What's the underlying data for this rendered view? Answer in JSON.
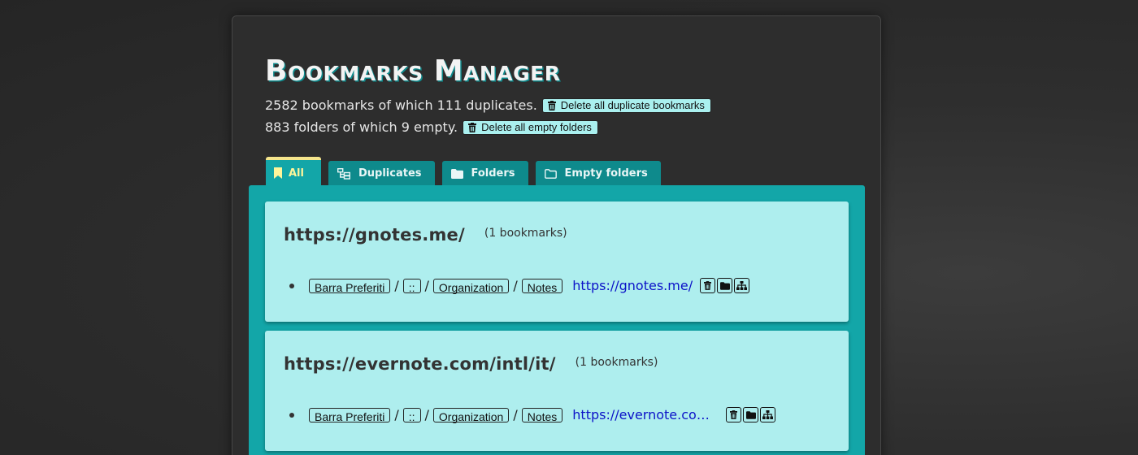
{
  "app": {
    "title": "Bookmarks Manager"
  },
  "stats": {
    "bookmarks_text": "2582 bookmarks of which 111 duplicates.",
    "delete_duplicates_label": "Delete all duplicate bookmarks",
    "folders_text": "883 folders of which 9 empty.",
    "delete_empty_label": "Delete all empty folders"
  },
  "tabs": [
    {
      "label": "All",
      "icon": "bookmark-icon",
      "active": true
    },
    {
      "label": "Duplicates",
      "icon": "tree-icon",
      "active": false
    },
    {
      "label": "Folders",
      "icon": "folder-icon",
      "active": false
    },
    {
      "label": "Empty folders",
      "icon": "folder-open-outline-icon",
      "active": false
    }
  ],
  "groups": [
    {
      "url": "https://gnotes.me/",
      "count_text": "(1 bookmarks)",
      "bookmarks": [
        {
          "path": [
            "Barra Preferiti",
            "::",
            "Organization",
            "Notes"
          ],
          "link": "https://gnotes.me/",
          "actions": [
            "trash-icon",
            "folder-icon",
            "sitemap-icon"
          ]
        }
      ]
    },
    {
      "url": "https://evernote.com/intl/it/",
      "count_text": "(1 bookmarks)",
      "bookmarks": [
        {
          "path": [
            "Barra Preferiti",
            "::",
            "Organization",
            "Notes"
          ],
          "link": "https://evernote.com...",
          "actions": [
            "trash-icon",
            "folder-icon",
            "sitemap-icon"
          ]
        }
      ]
    }
  ],
  "path_separator": "/",
  "colors": {
    "accent": "#13a6a8",
    "tab_inactive": "#0e8a8c",
    "card_bg": "#aeeeee",
    "active_tab_text": "#fff59a",
    "link": "#0c13c8"
  }
}
